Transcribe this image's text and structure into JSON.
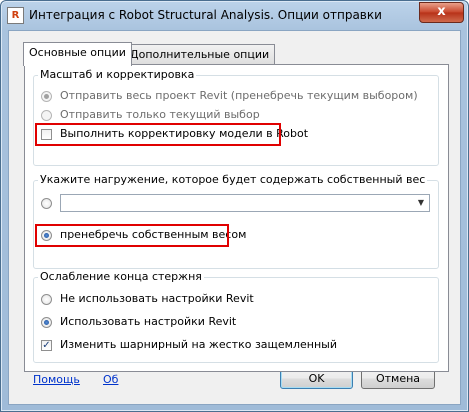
{
  "window": {
    "title": "Интеграция с Robot Structural Analysis. Опции отправки",
    "close_glyph": "x",
    "icon_glyph": "R"
  },
  "tabs": [
    {
      "label": "Основные опции",
      "active": true
    },
    {
      "label": "Дополнительные опции",
      "active": false
    }
  ],
  "scale_group": {
    "title": "Масштаб и корректировка",
    "send_whole_project": {
      "label": "Отправить весь проект Revit (пренебречь текущим выбором)",
      "checked": true,
      "disabled": true
    },
    "send_selection_only": {
      "label": "Отправить только текущий выбор",
      "checked": false,
      "disabled": true
    },
    "adjust_model": {
      "label": "Выполнить корректировку модели в Robot",
      "checked": false
    }
  },
  "load_group": {
    "title": "Укажите нагружение, которое будет содержать собственный вес",
    "load_case_combo": {
      "value": "",
      "arrow_icon": "chevron-down-icon",
      "checked": false
    },
    "ignore_self_weight": {
      "label": "пренебречь собственным весом",
      "checked": true
    }
  },
  "release_group": {
    "title": "Ослабление конца стержня",
    "do_not_use_revit": {
      "label": "Не использовать настройки Revit",
      "checked": false
    },
    "use_revit": {
      "label": "Использовать настройки Revit",
      "checked": true
    },
    "change_pinned": {
      "label": "Изменить шарнирный на жестко защемленный",
      "checked": true,
      "check_glyph": "✓"
    }
  },
  "footer": {
    "help_link": "Помощь",
    "about_link": "Об",
    "ok_button": "OK",
    "cancel_button": "Отмена"
  },
  "annotation_color": "#e00000"
}
